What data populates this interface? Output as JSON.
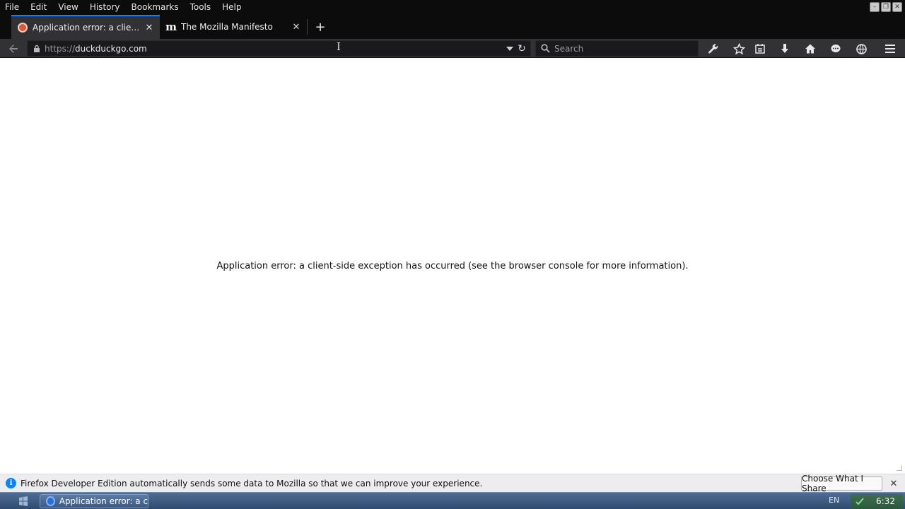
{
  "menubar": {
    "items": [
      "File",
      "Edit",
      "View",
      "History",
      "Bookmarks",
      "Tools",
      "Help"
    ]
  },
  "tabs": [
    {
      "title": "Application error: a client-side exception has occurred",
      "active": true,
      "favicon": "duckduckgo-favicon"
    },
    {
      "title": "The Mozilla Manifesto",
      "active": false,
      "favicon": "mozilla-favicon"
    }
  ],
  "navbar": {
    "url_protocol": "https://",
    "url_host": "duckduckgo.com",
    "search_placeholder": "Search"
  },
  "toolbar_icons": [
    "wrench-icon",
    "bookmark-star-icon",
    "library-icon",
    "download-icon",
    "home-icon",
    "chat-icon",
    "network-icon",
    "menu-icon"
  ],
  "content": {
    "error_message": "Application error: a client-side exception has occurred (see the browser console for more information)."
  },
  "notification": {
    "text": "Firefox Developer Edition automatically sends some data to Mozilla so that we can improve your experience.",
    "button_label": "Choose What I Share"
  },
  "taskbar": {
    "task_title": "Application error: a cli...",
    "language": "EN",
    "clock": "6:32"
  },
  "colors": {
    "chrome_dark": "#0c0c0d",
    "toolbar": "#323234",
    "accent": "#0a84ff",
    "notification_bg": "#ededf0"
  }
}
